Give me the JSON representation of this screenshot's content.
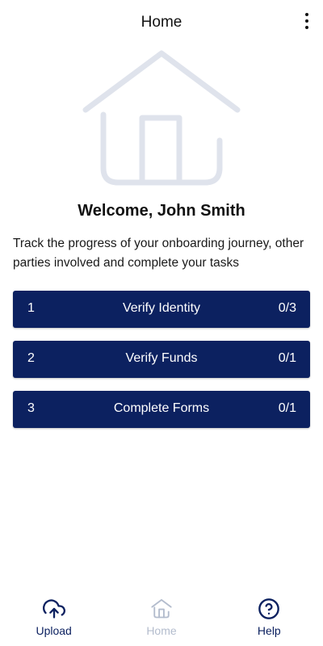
{
  "header": {
    "title": "Home",
    "menu_icon": "more-vertical-icon"
  },
  "hero": {
    "icon": "house-icon",
    "color": "#dfe3ec"
  },
  "welcome": {
    "text": "Welcome, John Smith"
  },
  "intro": {
    "text": "Track the progress of your onboarding journey, other parties involved and complete your tasks"
  },
  "steps": [
    {
      "number": "1",
      "label": "Verify Identity",
      "progress": "0/3"
    },
    {
      "number": "2",
      "label": "Verify Funds",
      "progress": "0/1"
    },
    {
      "number": "3",
      "label": "Complete Forms",
      "progress": "0/1"
    }
  ],
  "bottom_nav": {
    "upload": {
      "label": "Upload",
      "icon": "upload-cloud-icon"
    },
    "home": {
      "label": "Home",
      "icon": "home-icon",
      "active": true
    },
    "help": {
      "label": "Help",
      "icon": "help-circle-icon"
    }
  },
  "colors": {
    "primary": "#0c2160",
    "inactive": "#b3bccd",
    "hero": "#dfe3ec"
  }
}
